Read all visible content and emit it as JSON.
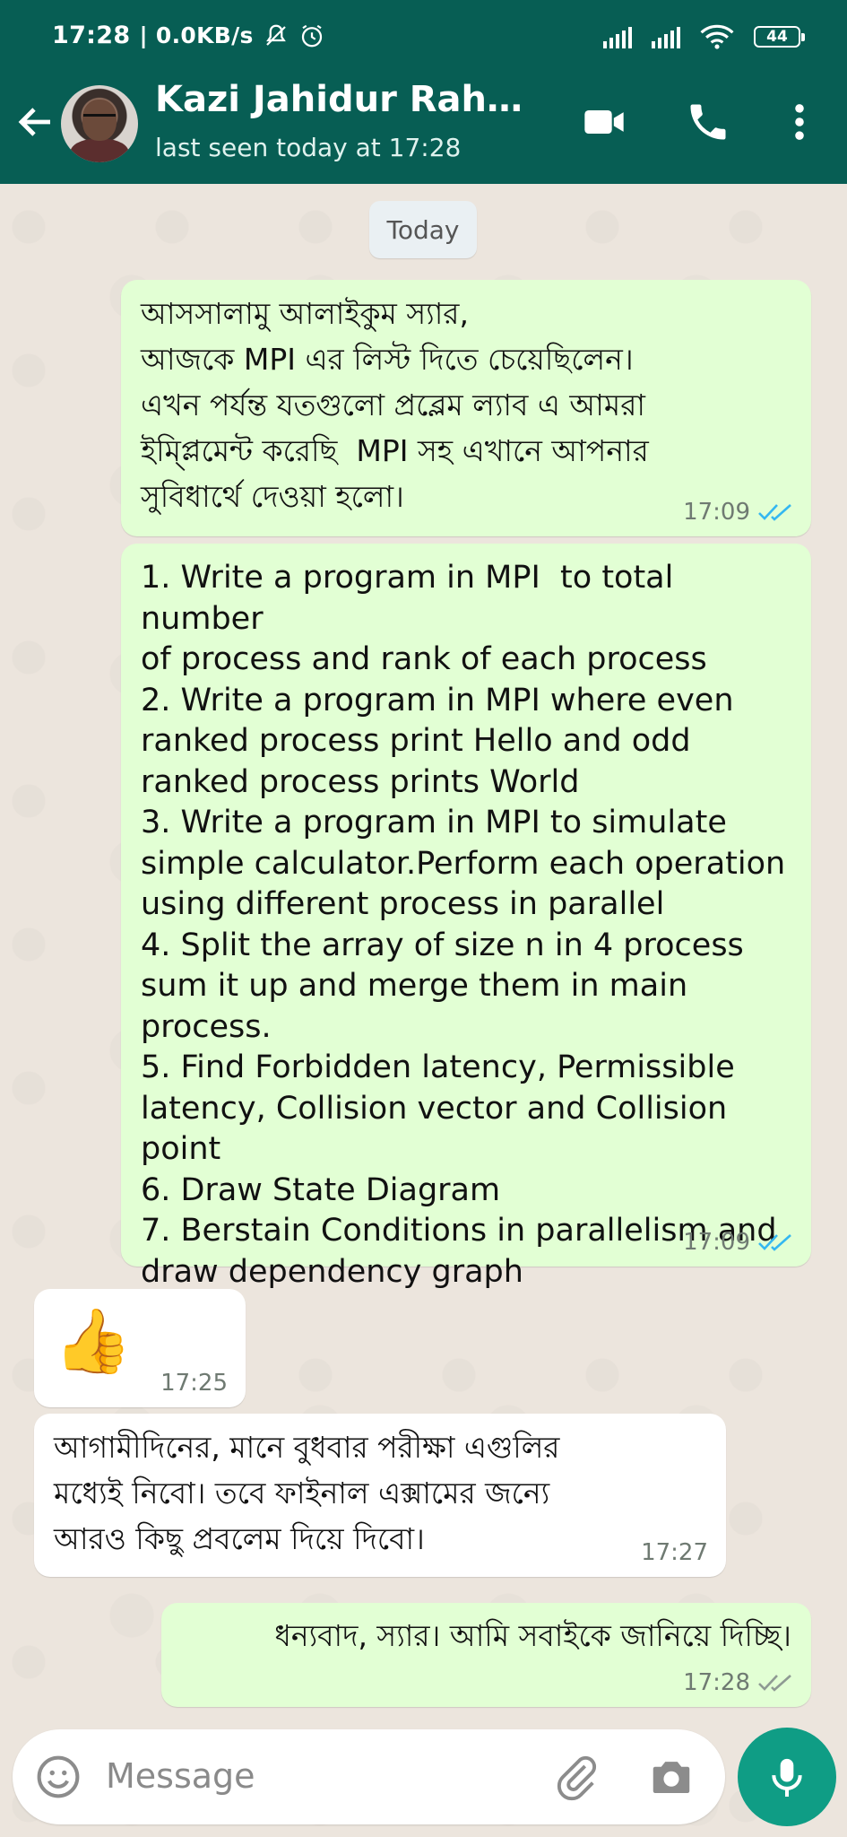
{
  "status_bar": {
    "time": "17:28",
    "speed": "| 0.0KB/s",
    "battery": "44"
  },
  "header": {
    "contact_name": "Kazi Jahidur Rahma...",
    "last_seen": "last seen today at 17:28"
  },
  "date_chip": "Today",
  "messages": [
    {
      "direction": "outgoing",
      "text": "আসসালামু আলাইকুম স্যার,\nআজকে MPI এর লিস্ট দিতে চেয়েছিলেন।\nএখন পর্যন্ত যতগুলো প্রব্লেম ল্যাব এ আমরা\nইম্প্লিমেন্ট করেছি  MPI সহ এখানে আপনার\nসুবিধার্থে দেওয়া হলো।",
      "time": "17:09",
      "status": "read"
    },
    {
      "direction": "outgoing",
      "text": "1. Write a program in MPI  to total number\nof process and rank of each process\n2. Write a program in MPI where even\nranked process print Hello and odd\nranked process prints World\n3. Write a program in MPI to simulate\nsimple calculator.Perform each operation\nusing different process in parallel\n4. Split the array of size n in 4 process\nsum it up and merge them in main\nprocess.\n5. Find Forbidden latency, Permissible\nlatency, Collision vector and Collision\npoint\n6. Draw State Diagram\n7. Berstain Conditions in parallelism and\ndraw dependency graph",
      "time": "17:09",
      "status": "read"
    },
    {
      "direction": "incoming",
      "text": "👍",
      "time": "17:25"
    },
    {
      "direction": "incoming",
      "text": "আগামীদিনের, মানে বুধবার পরীক্ষা এগুলির\nমধ্যেই নিবো। তবে ফাইনাল এক্সামের জন্যে\nআরও কিছু প্রবলেম দিয়ে দিবো।",
      "time": "17:27"
    },
    {
      "direction": "outgoing",
      "text": "ধন্যবাদ, স্যার। আমি সবাইকে জানিয়ে দিচ্ছি।",
      "time": "17:28",
      "status": "delivered"
    }
  ],
  "input": {
    "placeholder": "Message"
  },
  "colors": {
    "header": "#075E54",
    "outgoing_bubble": "#E2FFD4",
    "incoming_bubble": "#FFFFFF",
    "read_ticks": "#34B7F1",
    "mic_button": "#0F9D85"
  },
  "icons": [
    "back-arrow-icon",
    "video-call-icon",
    "phone-icon",
    "more-vert-icon",
    "emoji-icon",
    "attach-icon",
    "camera-icon",
    "mic-icon",
    "alarm-icon",
    "mute-icon",
    "wifi-icon",
    "signal-icon",
    "battery-icon"
  ]
}
